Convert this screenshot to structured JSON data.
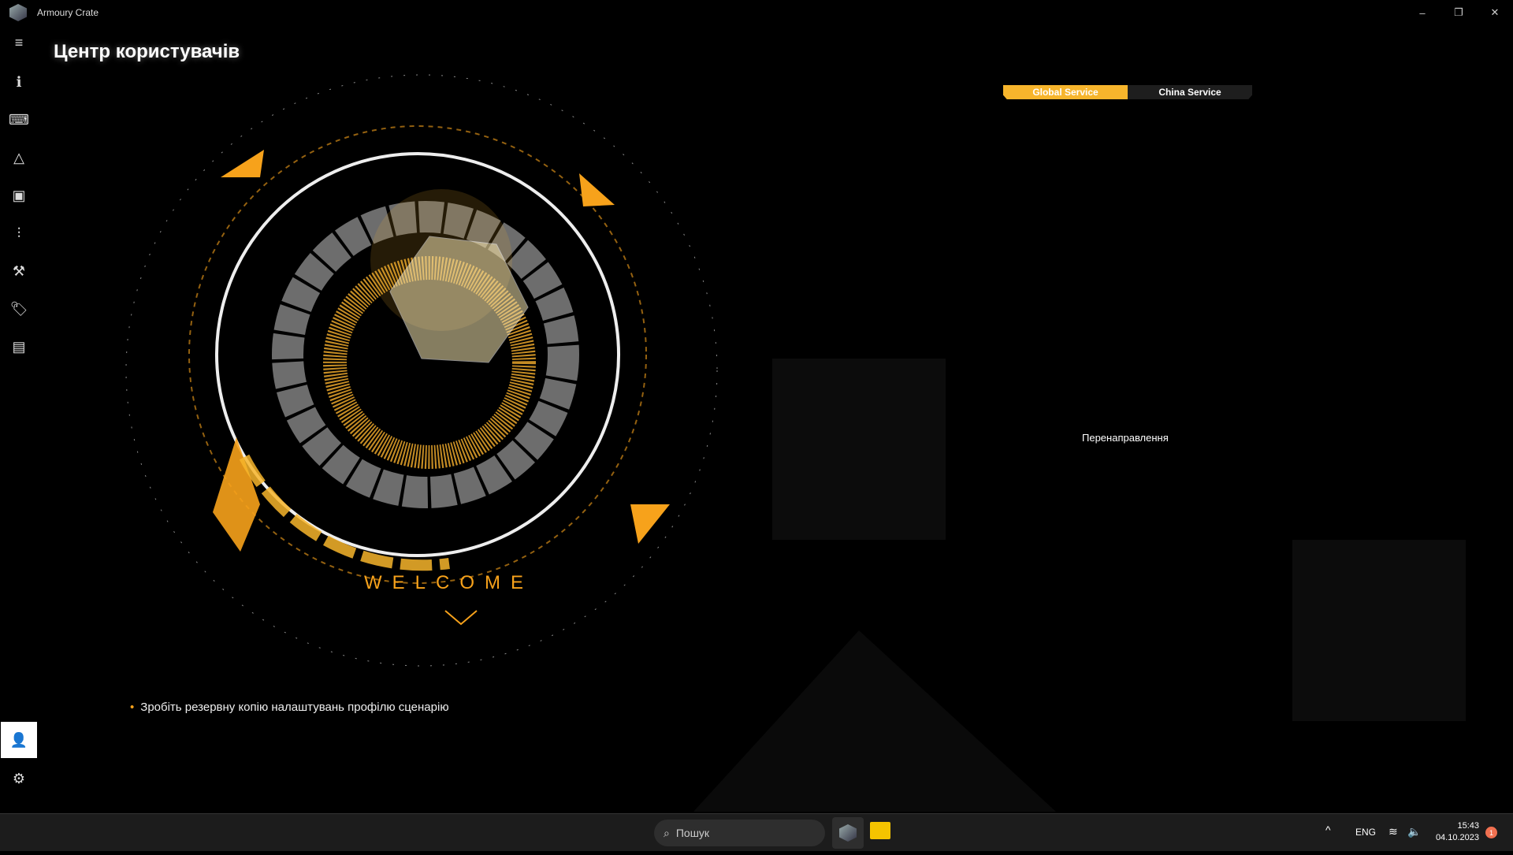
{
  "window": {
    "title": "Armoury Crate",
    "minimize": "–",
    "restore": "❐",
    "close": "✕"
  },
  "sidebar": {
    "items": [
      {
        "name": "menu",
        "icon": "≡"
      },
      {
        "name": "home",
        "icon": "ℹ"
      },
      {
        "name": "device",
        "icon": "⌨"
      },
      {
        "name": "aura",
        "icon": "△"
      },
      {
        "name": "game-library",
        "icon": "▣"
      },
      {
        "name": "scenario-profiles",
        "icon": "⫶"
      },
      {
        "name": "tools",
        "icon": "⚒"
      },
      {
        "name": "deals",
        "icon": "🏷"
      },
      {
        "name": "news",
        "icon": "▤"
      }
    ],
    "user": "👤",
    "settings": "⚙"
  },
  "page": {
    "title": "Центр користувачів",
    "welcome": "WELCOME"
  },
  "service_tabs": {
    "global": "Global Service",
    "china": "China Service",
    "active": "global",
    "accent": "#f7b52c"
  },
  "redirect_text": "Перенаправлення",
  "tip": "Зробіть резервну копію налаштувань профілю сценарію",
  "taskbar": {
    "search_placeholder": "Пошук",
    "lang": "ENG",
    "time": "15:43",
    "date": "04.10.2023",
    "notifications": "1"
  }
}
